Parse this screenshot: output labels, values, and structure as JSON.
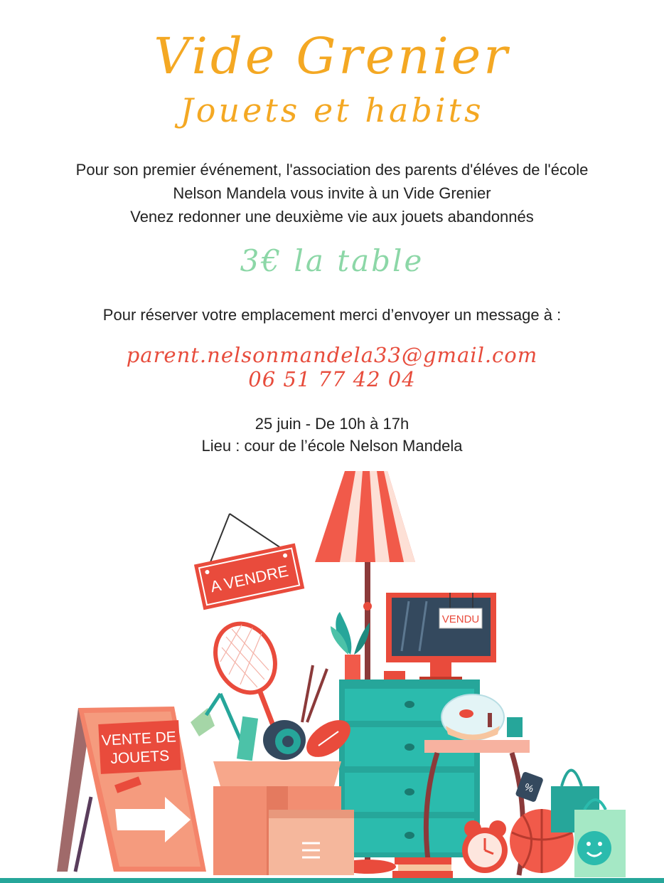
{
  "header": {
    "title": "Vide Grenier",
    "subtitle": "Jouets et habits"
  },
  "intro": {
    "line1": "Pour son premier événement, l'association des parents d'éléves de l'école",
    "line2": "Nelson Mandela vous invite à un  Vide Grenier",
    "line3": "Venez redonner une deuxième vie aux jouets abandonnés"
  },
  "price": "3€ la table",
  "reserve": "Pour réserver votre emplacement merci d’envoyer un message à :",
  "contact": {
    "email": "parent.nelsonmandela33@gmail.com",
    "phone": "06 51 77 42 04"
  },
  "event": {
    "date_time": "25 juin - De 10h à 17h",
    "location": "Lieu : cour de l’école Nelson Mandela"
  },
  "illustration": {
    "sign_for_sale": "A VENDRE",
    "sign_sold": "VENDU",
    "board_line1": "VENTE DE",
    "board_line2": "JOUETS",
    "tag_percent": "%"
  },
  "colors": {
    "title": "#f4a823",
    "price": "#8cd7a7",
    "contact": "#e74c3c",
    "accent_red": "#e94b3c",
    "teal": "#26a69a"
  }
}
